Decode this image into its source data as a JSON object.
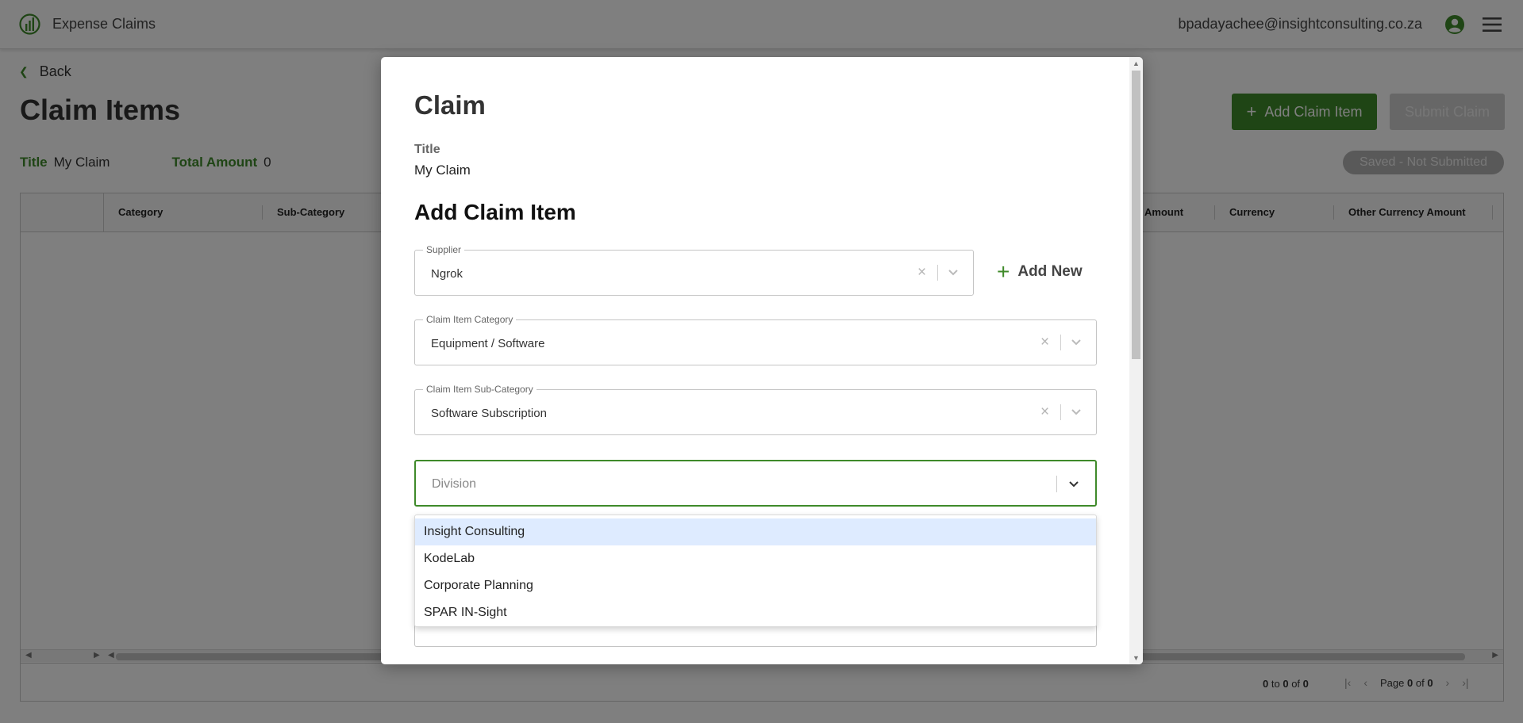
{
  "header": {
    "app_title": "Expense Claims",
    "user_email": "bpadayachee@insightconsulting.co.za",
    "icons": {
      "logo": "chart-logo-icon",
      "user": "user-circle-icon",
      "menu": "hamburger-menu-icon"
    }
  },
  "page": {
    "back_label": "Back",
    "title": "Claim Items",
    "meta": {
      "title_label": "Title",
      "title_value": "My Claim",
      "amount_label": "Total Amount",
      "amount_value": "0"
    },
    "add_item_button": "Add Claim Item",
    "submit_button": "Submit Claim",
    "status": "Saved - Not Submitted"
  },
  "grid": {
    "columns_left": [
      "Category",
      "Sub-Category"
    ],
    "columns_right": [
      "Amount",
      "Currency",
      "Other Currency Amount"
    ],
    "footer": {
      "range_from": "0",
      "range_to": "0",
      "total": "0",
      "to_word": "to",
      "of_word": "of",
      "page_word": "Page",
      "page_current": "0",
      "page_total": "0"
    }
  },
  "modal": {
    "heading": "Claim",
    "title_label": "Title",
    "title_value": "My Claim",
    "subheading": "Add Claim Item",
    "supplier": {
      "legend": "Supplier",
      "value": "Ngrok"
    },
    "add_new_label": "Add New",
    "category": {
      "legend": "Claim Item Category",
      "value": "Equipment / Software"
    },
    "subcategory": {
      "legend": "Claim Item Sub-Category",
      "value": "Software Subscription"
    },
    "division": {
      "placeholder": "Division",
      "options": [
        "Insight Consulting",
        "KodeLab",
        "Corporate Planning",
        "SPAR IN-Sight"
      ],
      "focused_option": "Insight Consulting"
    }
  },
  "colors": {
    "brand_green": "#3f8a2a",
    "option_focus": "#deebff",
    "disabled": "#cfcfcf"
  }
}
